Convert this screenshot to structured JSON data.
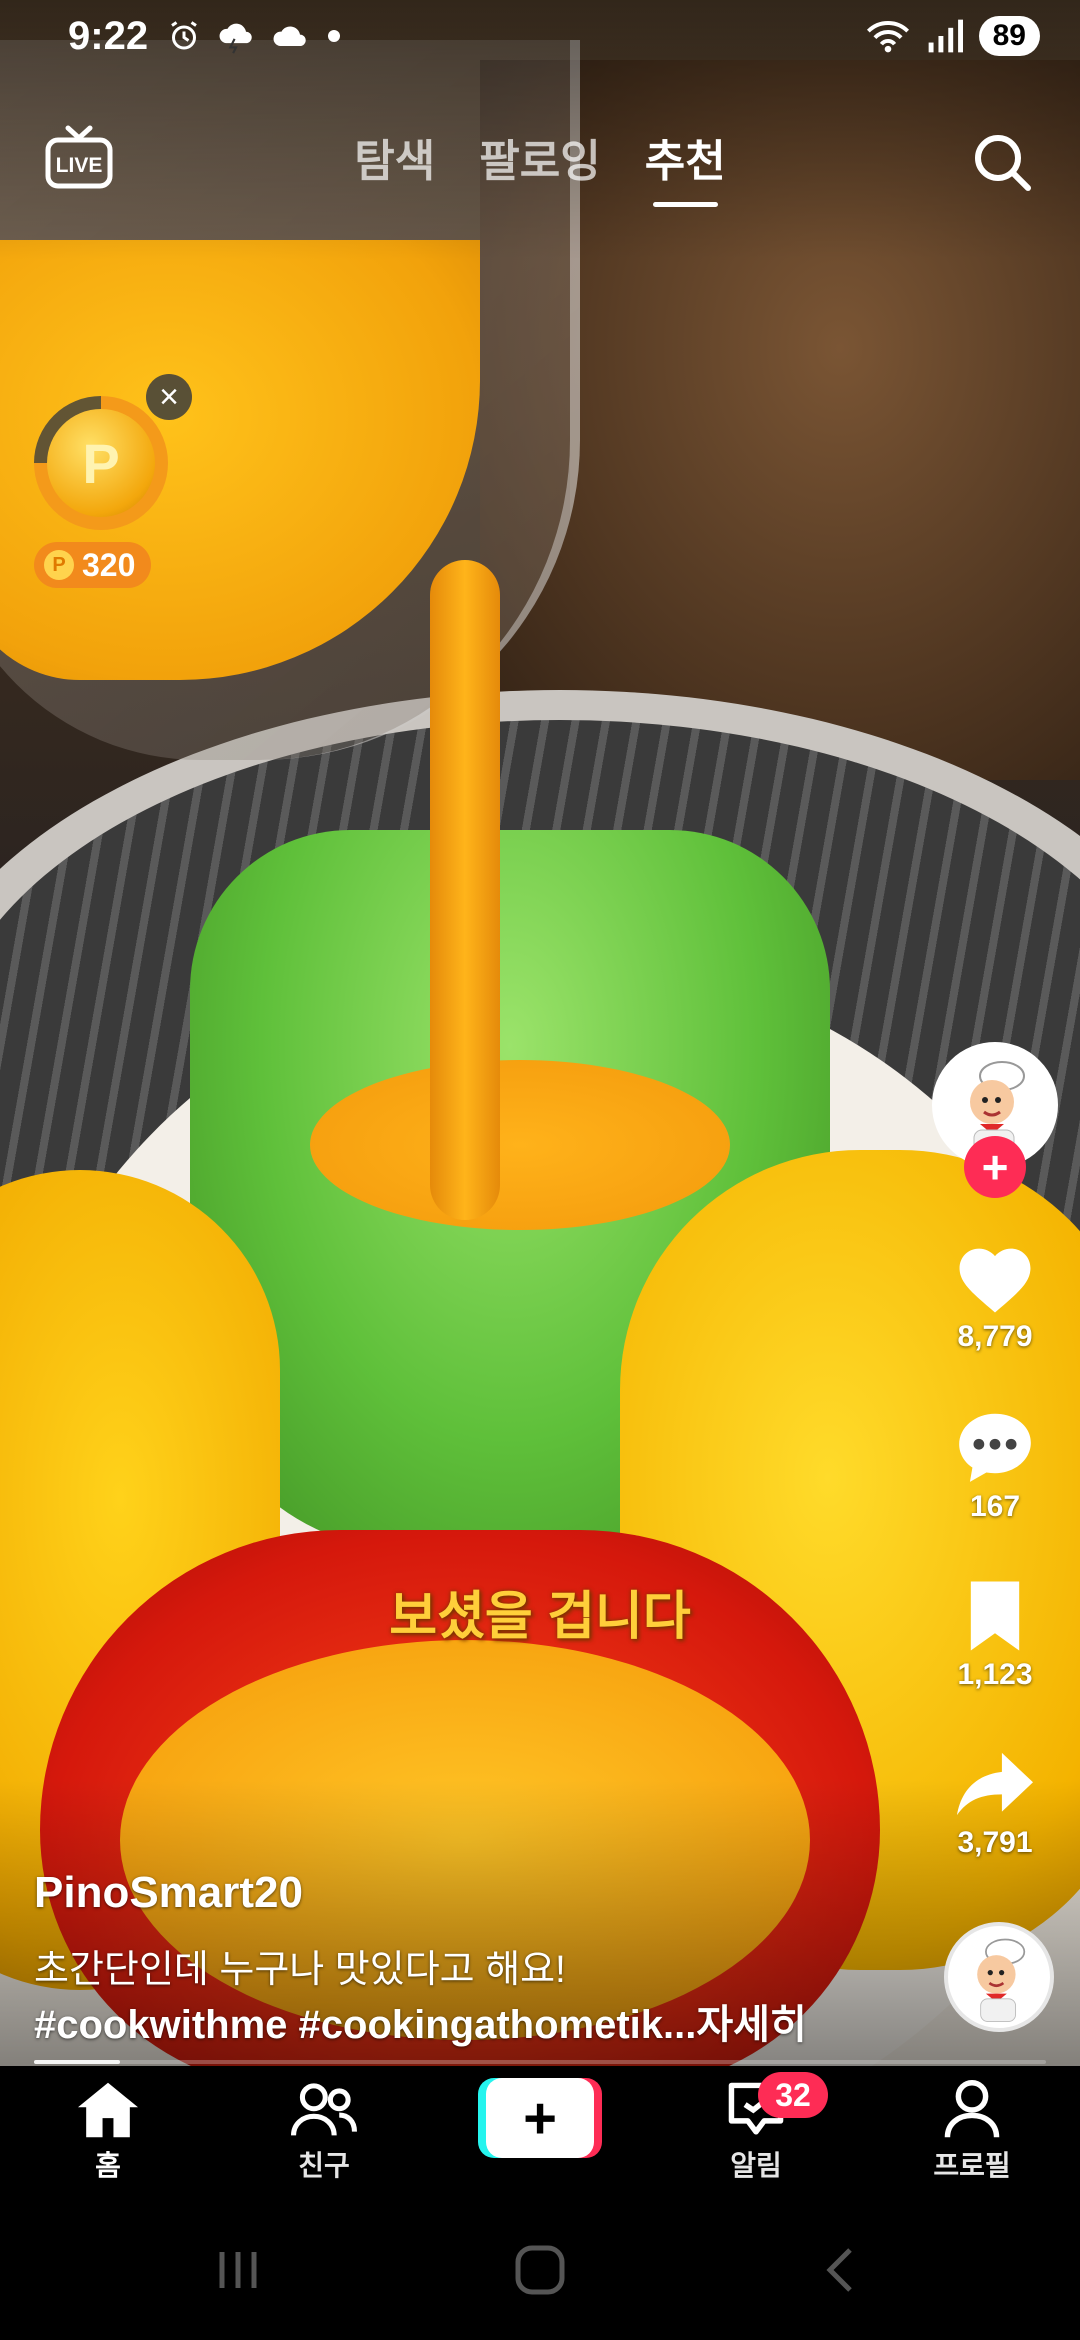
{
  "status": {
    "time": "9:22",
    "battery": "89"
  },
  "tabs": [
    {
      "label": "탐색",
      "active": false
    },
    {
      "label": "팔로잉",
      "active": false
    },
    {
      "label": "추천",
      "active": true
    }
  ],
  "live_label": "LIVE",
  "coin": {
    "points": "320",
    "progress": 0.75
  },
  "video": {
    "subtitle": "보셨을 겁니다"
  },
  "actions": {
    "likes": "8,779",
    "comments": "167",
    "saves": "1,123",
    "shares": "3,791"
  },
  "caption": {
    "username": "PinoSmart20",
    "description": "초간단인데 누구나 맛있다고 해요!",
    "hashtags": "#cookwithme #cookingathometik...",
    "more_label": "자세히"
  },
  "playback": {
    "progress": 0.085
  },
  "bottom_nav": {
    "home": "홈",
    "friends": "친구",
    "inbox": "알림",
    "profile": "프로필",
    "inbox_badge": "32"
  },
  "colors": {
    "accent": "#fe2c55",
    "cyan": "#25f4ee",
    "coin": "#f28a1c",
    "subtitle": "#ffcf3a"
  }
}
